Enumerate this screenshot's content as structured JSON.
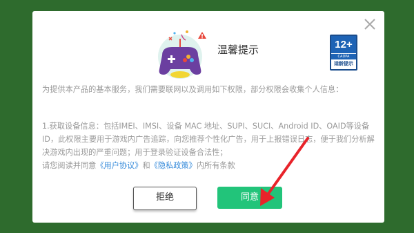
{
  "dialog": {
    "title": "温馨提示",
    "age_rating": {
      "number": "12+",
      "org": "CADPA",
      "label": "适龄提示"
    },
    "intro": "为提供本产品的基本服务，我们需要联网以及调用如下权限，部分权限会收集个人信息：",
    "item1": "1.获取设备信息：包括IMEI、IMSI、设备 MAC 地址、SUPI、SUCI、Android ID、OAID等设备ID，此权限主要用于游戏内广告追踪，向您推荐个性化广告，用于上报错误日志，便于我们分析解决游戏内出现的严重问题；用于登录验证设备合法性；",
    "consent_prefix": "请您阅读并同意",
    "user_agreement": "《用户协议》",
    "and": "和",
    "privacy_policy": "《隐私政策》",
    "consent_suffix": "内所有条款",
    "refuse_label": "拒绝",
    "agree_label": "同意"
  },
  "icons": {
    "close": "close-icon",
    "header": "gamepad-icon",
    "warning": "warning-icon",
    "annotation": "red-arrow"
  },
  "colors": {
    "background": "#2e6b2d",
    "agree": "#22c47a",
    "link": "#3a8ddb",
    "arrow": "#e8232a"
  }
}
